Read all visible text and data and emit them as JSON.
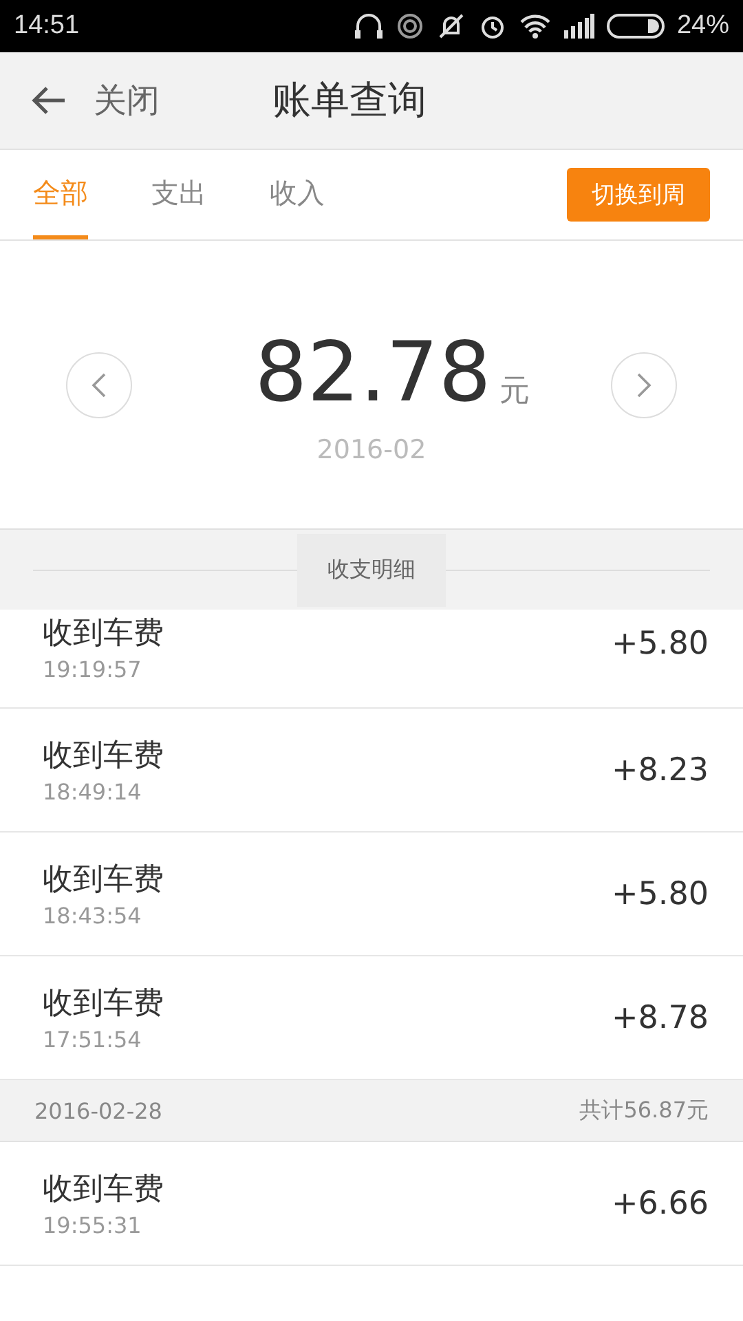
{
  "status_bar": {
    "time": "14:51",
    "battery": "24%"
  },
  "header": {
    "back_label": "关闭",
    "title": "账单查询"
  },
  "tabs": [
    {
      "label": "全部",
      "selected": true
    },
    {
      "label": "支出",
      "selected": false
    },
    {
      "label": "收入",
      "selected": false
    }
  ],
  "switch_button": "切换到周",
  "summary": {
    "amount": "82.78",
    "unit": "元",
    "period": "2016-02"
  },
  "section_title": "收支明细",
  "rows": [
    {
      "kind": "entry",
      "title": "收到车费",
      "time": "19:19:57",
      "amount": "+5.80"
    },
    {
      "kind": "entry",
      "title": "收到车费",
      "time": "18:49:14",
      "amount": "+8.23"
    },
    {
      "kind": "entry",
      "title": "收到车费",
      "time": "18:43:54",
      "amount": "+5.80"
    },
    {
      "kind": "entry",
      "title": "收到车费",
      "time": "17:51:54",
      "amount": "+8.78"
    },
    {
      "kind": "date",
      "date": "2016-02-28",
      "total": "共计56.87元"
    },
    {
      "kind": "entry",
      "title": "收到车费",
      "time": "19:55:31",
      "amount": "+6.66"
    }
  ]
}
